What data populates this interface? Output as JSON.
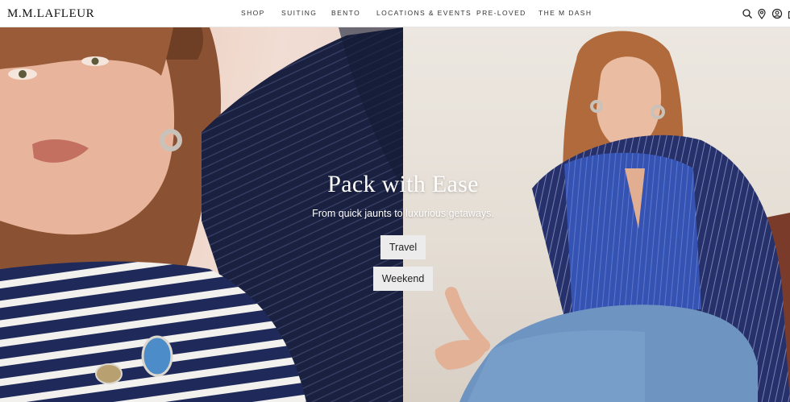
{
  "brand": {
    "logo": "M.M.LAFLEUR"
  },
  "nav": {
    "items": [
      "SHOP",
      "SUITING",
      "BENTO",
      "LOCATIONS & EVENTS",
      "PRE-LOVED",
      "THE M DASH"
    ]
  },
  "utility_icons": [
    "search-icon",
    "location-pin-icon",
    "account-icon",
    "bag-icon"
  ],
  "hero": {
    "title": "Pack with Ease",
    "subtitle": "From quick jaunts to luxurious getaways.",
    "buttons": [
      "Travel",
      "Weekend"
    ]
  }
}
